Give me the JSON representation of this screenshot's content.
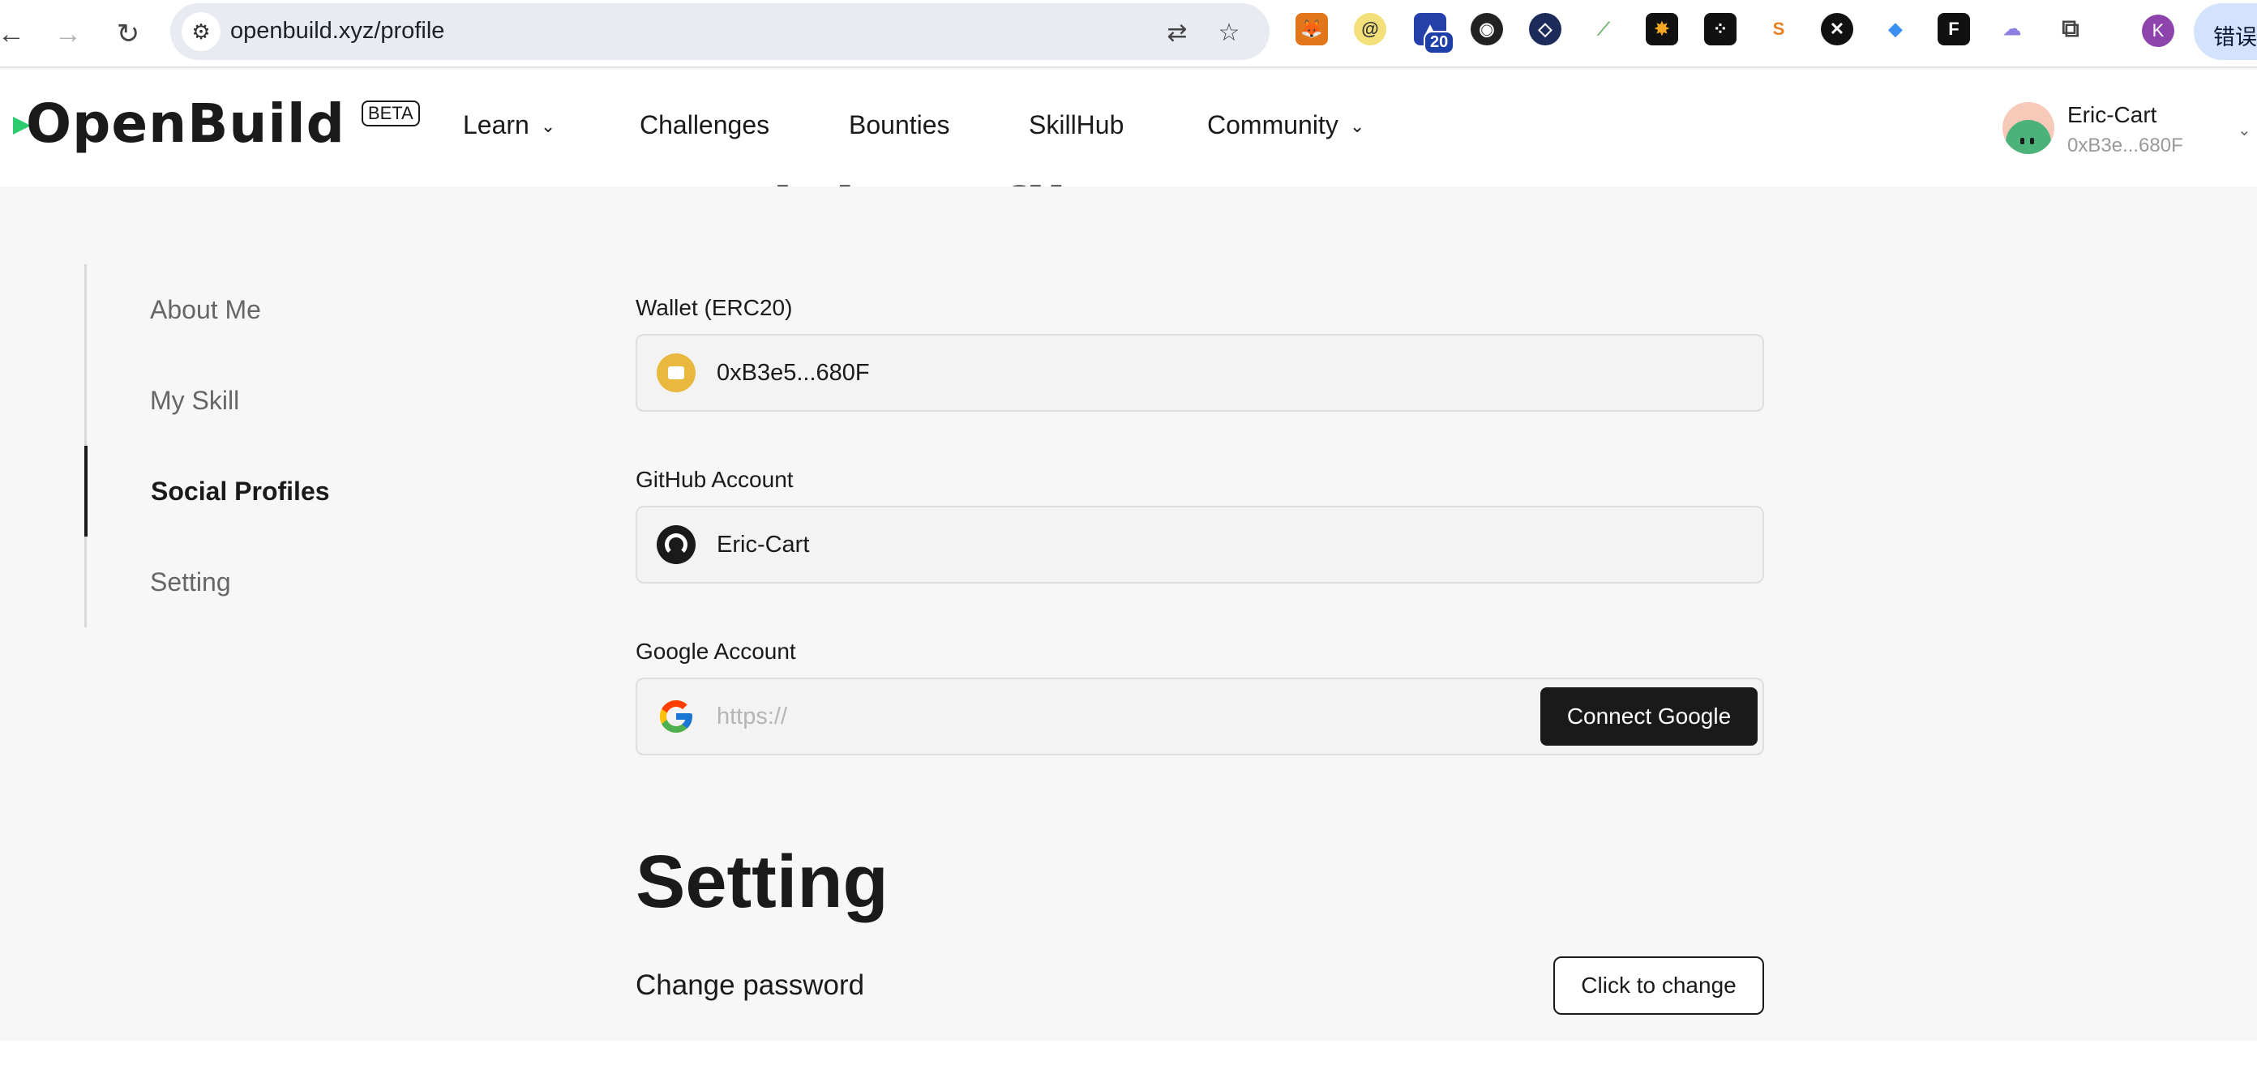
{
  "browser": {
    "url": "openbuild.xyz/profile",
    "badge_count": "20",
    "profile_initial": "K",
    "right_pill": "错误"
  },
  "site": {
    "logo": "OpenBuild",
    "beta": "BETA",
    "nav": [
      {
        "label": "Learn",
        "has_menu": true
      },
      {
        "label": "Challenges",
        "has_menu": false
      },
      {
        "label": "Bounties",
        "has_menu": false
      },
      {
        "label": "SkillHub",
        "has_menu": false
      },
      {
        "label": "Community",
        "has_menu": true
      }
    ],
    "user": {
      "name": "Eric-Cart",
      "address": "0xB3e...680F"
    }
  },
  "sidebar": {
    "items": [
      {
        "label": "About Me",
        "active": false
      },
      {
        "label": "My Skill",
        "active": false
      },
      {
        "label": "Social Profiles",
        "active": true
      },
      {
        "label": "Setting",
        "active": false
      }
    ]
  },
  "social": {
    "cut_heading": "Social Profiles",
    "wallet": {
      "label": "Wallet (ERC20)",
      "value": "0xB3e5...680F"
    },
    "github": {
      "label": "GitHub Account",
      "value": "Eric-Cart"
    },
    "google": {
      "label": "Google Account",
      "placeholder": "https://",
      "button": "Connect Google"
    }
  },
  "setting": {
    "title": "Setting",
    "change_password_label": "Change password",
    "change_button": "Click to change"
  },
  "colors": {
    "accent": "#1a1a1a",
    "wallet": "#e8b83f",
    "logo_green": "#2ecc71",
    "background": "#f7f7f7"
  }
}
